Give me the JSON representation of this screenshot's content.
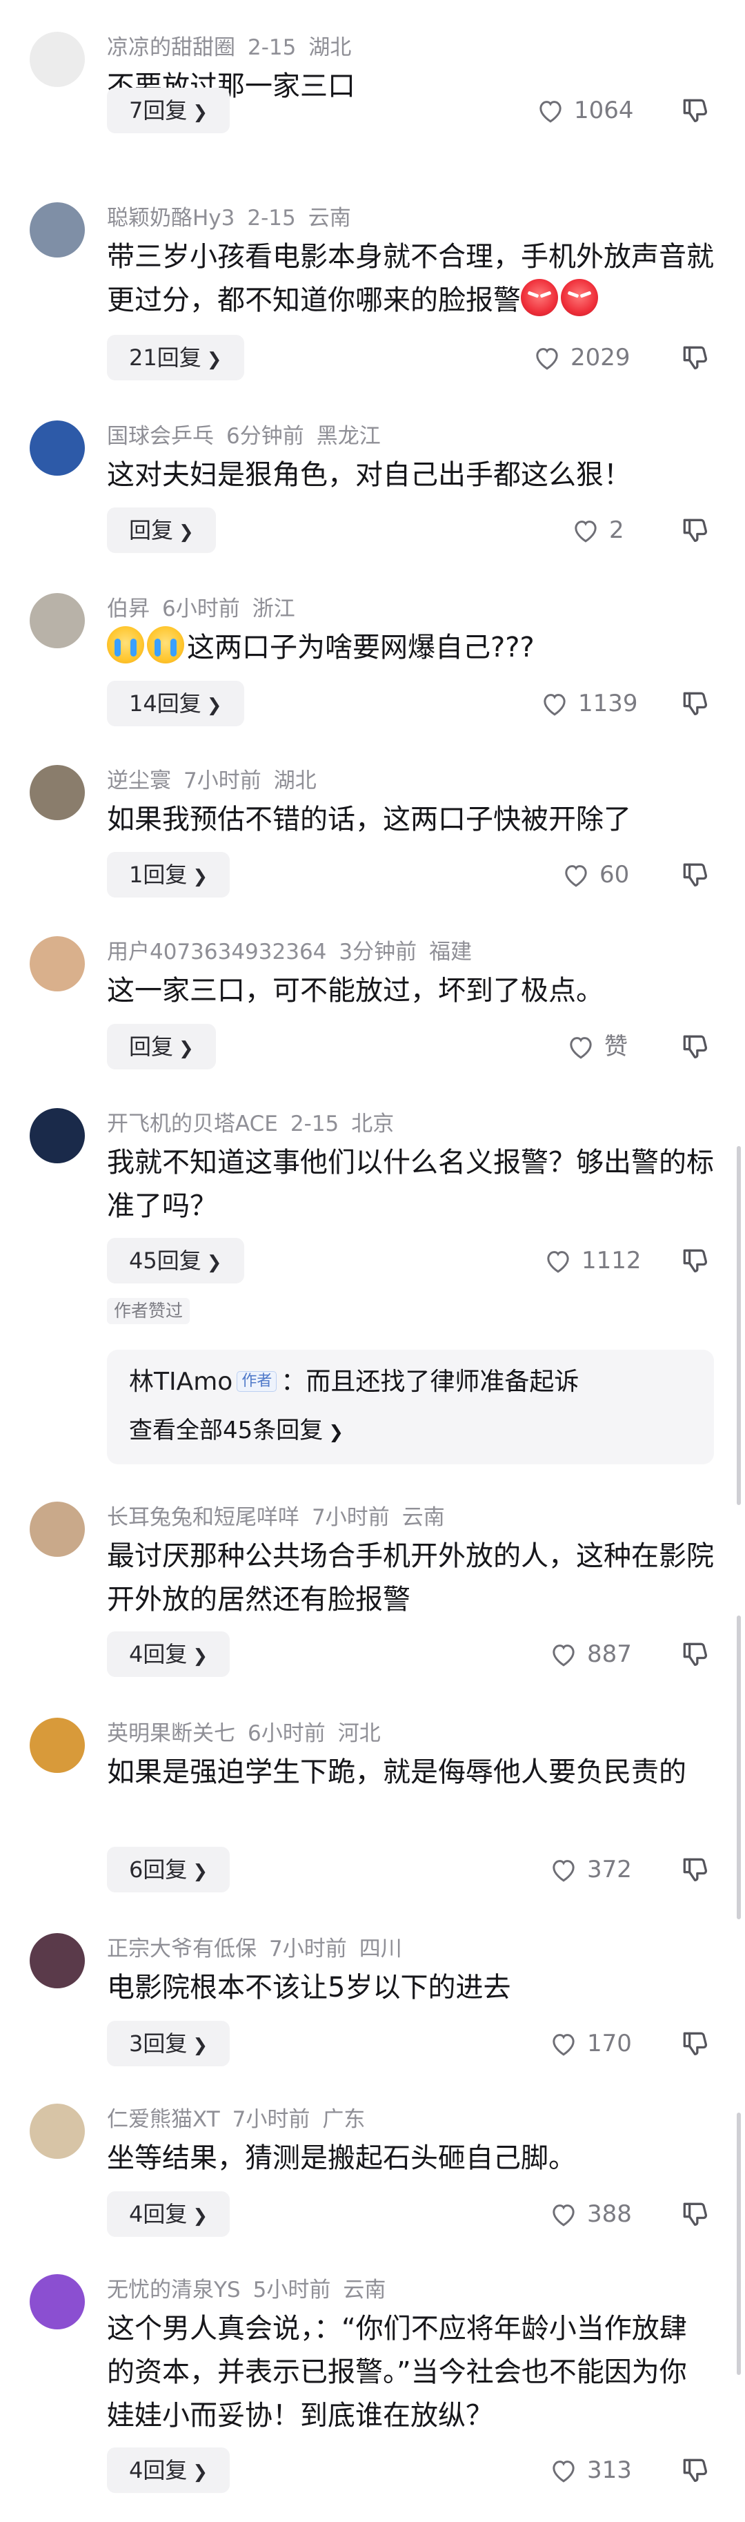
{
  "comments": [
    {
      "user": "凉凉的甜甜圈",
      "time": "2-15",
      "location": "湖北",
      "text": "不要放过那一家三口",
      "reply": "7回复",
      "likes": "1064"
    },
    {
      "user": "聪颖奶酪Hy3",
      "time": "2-15",
      "location": "云南",
      "text": "带三岁小孩看电影本身就不合理，手机外放声音就更过分，都不知道你哪来的脸报警",
      "reply": "21回复",
      "likes": "2029"
    },
    {
      "user": "国球会乒乓",
      "time": "6分钟前",
      "location": "黑龙江",
      "text": "这对夫妇是狠角色，对自己出手都这么狠！",
      "reply": "回复",
      "likes": "2"
    },
    {
      "user": "伯昇",
      "time": "6小时前",
      "location": "浙江",
      "text": "这两口子为啥要网爆自己???",
      "reply": "14回复",
      "likes": "1139"
    },
    {
      "user": "逆尘寰",
      "time": "7小时前",
      "location": "湖北",
      "text": "如果我预估不错的话，这两口子快被开除了",
      "reply": "1回复",
      "likes": "60"
    },
    {
      "user": "用户4073634932364",
      "time": "3分钟前",
      "location": "福建",
      "text": "这一家三口，可不能放过，坏到了极点。",
      "reply": "回复",
      "likes": "赞"
    },
    {
      "user": "开飞机的贝塔ACE",
      "time": "2-15",
      "location": "北京",
      "text": "我就不知道这事他们以什么名义报警？够出警的标准了吗？",
      "reply": "45回复",
      "likes": "1112",
      "author_liked": "作者赞过",
      "sub_reply": {
        "author": "林TIAmo",
        "badge": "作者",
        "text": "：而且还找了律师准备起诉",
        "view_all": "查看全部45条回复"
      }
    },
    {
      "user": "长耳兔兔和短尾咩咩",
      "time": "7小时前",
      "location": "云南",
      "text": "最讨厌那种公共场合手机开外放的人，这种在影院开外放的居然还有脸报警",
      "reply": "4回复",
      "likes": "887"
    },
    {
      "user": "英明果断关七",
      "time": "6小时前",
      "location": "河北",
      "text": "如果是强迫学生下跪，就是侮辱他人要负民责的",
      "reply": "6回复",
      "likes": "372"
    },
    {
      "user": "正宗大爷有低保",
      "time": "7小时前",
      "location": "四川",
      "text": "电影院根本不该让5岁以下的进去",
      "reply": "3回复",
      "likes": "170"
    },
    {
      "user": "仁爱熊猫XT",
      "time": "7小时前",
      "location": "广东",
      "text": "坐等结果，猜测是搬起石头砸自己脚。",
      "reply": "4回复",
      "likes": "388"
    },
    {
      "user": "无忧的清泉YS",
      "time": "5小时前",
      "location": "云南",
      "text": "这个男人真会说，：“你们不应将年龄小当作放肆的资本，并表示已报警。”当今社会也不能因为你娃娃小而妥协！到底谁在放纵？",
      "reply": "4回复",
      "likes": "313"
    }
  ],
  "avatar_colors": [
    "#ececec",
    "#7f8fa6",
    "#2d5aa8",
    "#b8b2a8",
    "#8a7d6c",
    "#d9b08c",
    "#1a2a4a",
    "#c9a98a",
    "#d89a3a",
    "#5a3a4a",
    "#d7c4a6",
    "#8b4fd1"
  ],
  "icons": {
    "like": "heart-outline-icon",
    "dislike": "thumb-down-outline-icon",
    "chevron": "chevron-right-icon"
  }
}
